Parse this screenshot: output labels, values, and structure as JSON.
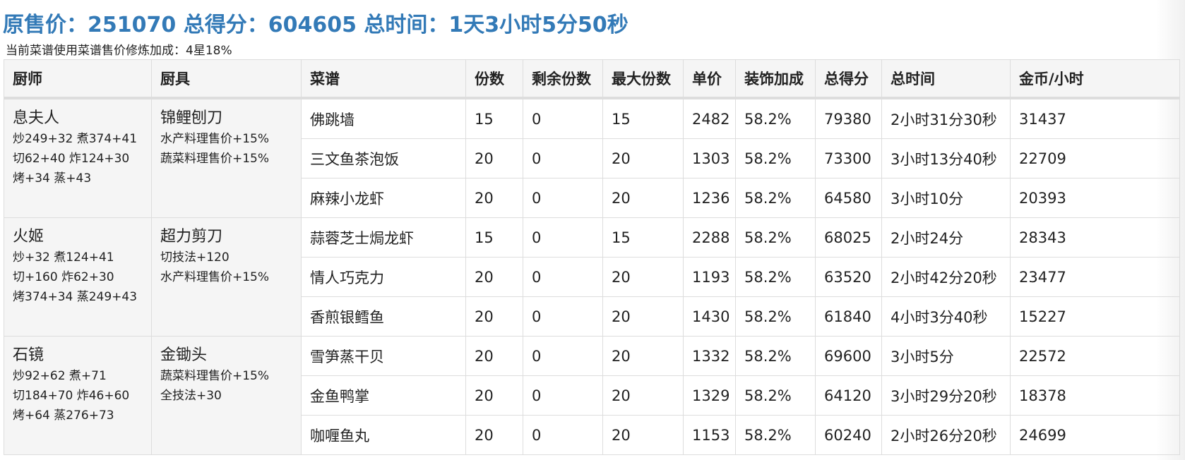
{
  "summary": {
    "original_price_label": "原售价：",
    "original_price": "251070",
    "total_score_label": "总得分：",
    "total_score": "604605",
    "total_time_label": "总时间：",
    "total_time": "1天3小时5分50秒"
  },
  "subline": "当前菜谱使用菜谱售价修炼加成：4星18%",
  "columns": [
    "厨师",
    "厨具",
    "菜谱",
    "份数",
    "剩余份数",
    "最大份数",
    "单价",
    "装饰加成",
    "总得分",
    "总时间",
    "金币/小时"
  ],
  "groups": [
    {
      "chef": {
        "name": "息夫人",
        "skills": [
          "炒249+32 煮374+41",
          "切62+40 炸124+30",
          "烤+34 蒸+43"
        ]
      },
      "equip": {
        "name": "锦鲤刨刀",
        "effects": [
          "水产料理售价+15%",
          "蔬菜料理售价+15%"
        ]
      },
      "recipes": [
        {
          "name": "佛跳墙",
          "qty": "15",
          "remaining": "0",
          "max": "15",
          "price": "2482",
          "deco": "58.2%",
          "score": "79380",
          "time": "2小时31分30秒",
          "gold_per_hour": "31437"
        },
        {
          "name": "三文鱼茶泡饭",
          "qty": "20",
          "remaining": "0",
          "max": "20",
          "price": "1303",
          "deco": "58.2%",
          "score": "73300",
          "time": "3小时13分40秒",
          "gold_per_hour": "22709"
        },
        {
          "name": "麻辣小龙虾",
          "qty": "20",
          "remaining": "0",
          "max": "20",
          "price": "1236",
          "deco": "58.2%",
          "score": "64580",
          "time": "3小时10分",
          "gold_per_hour": "20393"
        }
      ]
    },
    {
      "chef": {
        "name": "火姬",
        "skills": [
          "炒+32 煮124+41",
          "切+160 炸62+30",
          "烤374+34 蒸249+43"
        ]
      },
      "equip": {
        "name": "超力剪刀",
        "effects": [
          "切技法+120",
          "水产料理售价+15%"
        ]
      },
      "recipes": [
        {
          "name": "蒜蓉芝士焗龙虾",
          "qty": "15",
          "remaining": "0",
          "max": "15",
          "price": "2288",
          "deco": "58.2%",
          "score": "68025",
          "time": "2小时24分",
          "gold_per_hour": "28343"
        },
        {
          "name": "情人巧克力",
          "qty": "20",
          "remaining": "0",
          "max": "20",
          "price": "1193",
          "deco": "58.2%",
          "score": "63520",
          "time": "2小时42分20秒",
          "gold_per_hour": "23477"
        },
        {
          "name": "香煎银鳕鱼",
          "qty": "20",
          "remaining": "0",
          "max": "20",
          "price": "1430",
          "deco": "58.2%",
          "score": "61840",
          "time": "4小时3分40秒",
          "gold_per_hour": "15227"
        }
      ]
    },
    {
      "chef": {
        "name": "石镜",
        "skills": [
          "炒92+62 煮+71",
          "切184+70 炸46+60",
          "烤+64 蒸276+73"
        ]
      },
      "equip": {
        "name": "金锄头",
        "effects": [
          "蔬菜料理售价+15%",
          "全技法+30"
        ]
      },
      "recipes": [
        {
          "name": "雪笋蒸干贝",
          "qty": "20",
          "remaining": "0",
          "max": "20",
          "price": "1332",
          "deco": "58.2%",
          "score": "69600",
          "time": "3小时5分",
          "gold_per_hour": "22572"
        },
        {
          "name": "金鱼鸭掌",
          "qty": "20",
          "remaining": "0",
          "max": "20",
          "price": "1329",
          "deco": "58.2%",
          "score": "64120",
          "time": "3小时29分20秒",
          "gold_per_hour": "18378"
        },
        {
          "name": "咖喱鱼丸",
          "qty": "20",
          "remaining": "0",
          "max": "20",
          "price": "1153",
          "deco": "58.2%",
          "score": "60240",
          "time": "2小时26分20秒",
          "gold_per_hour": "24699"
        }
      ]
    }
  ]
}
